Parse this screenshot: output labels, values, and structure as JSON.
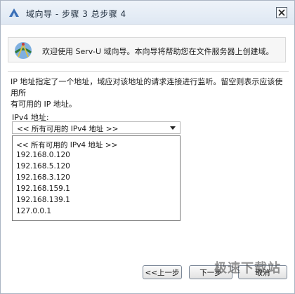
{
  "window": {
    "title": "域向导 - 步骤 3 总步骤 4",
    "icon": "serv-u-wizard-icon",
    "close_icon": "close-icon"
  },
  "intro": {
    "icon": "serv-u-globe-icon",
    "text": "欢迎使用 Serv-U 域向导。本向导将帮助您在文件服务器上创建域。"
  },
  "description": {
    "line1": "IP 地址指定了一个地址，域应对该地址的请求连接进行监听。留空则表示应该使用所",
    "line2": "有可用的 IP 地址。"
  },
  "ipv4": {
    "label": "IPv4 地址:",
    "selected": "<< 所有可用的 IPv4 地址 >>",
    "options": [
      "<< 所有可用的 IPv4 地址 >>",
      "192.168.0.120",
      "192.168.5.120",
      "192.168.3.120",
      "192.168.159.1",
      "192.168.139.1",
      "127.0.0.1"
    ]
  },
  "buttons": {
    "back": "<<上一步",
    "next": "下一步",
    "cancel": "取消"
  },
  "watermark": "极速下载站",
  "colors": {
    "titlebar": "#dfe8f3",
    "border": "#aab4c3"
  }
}
